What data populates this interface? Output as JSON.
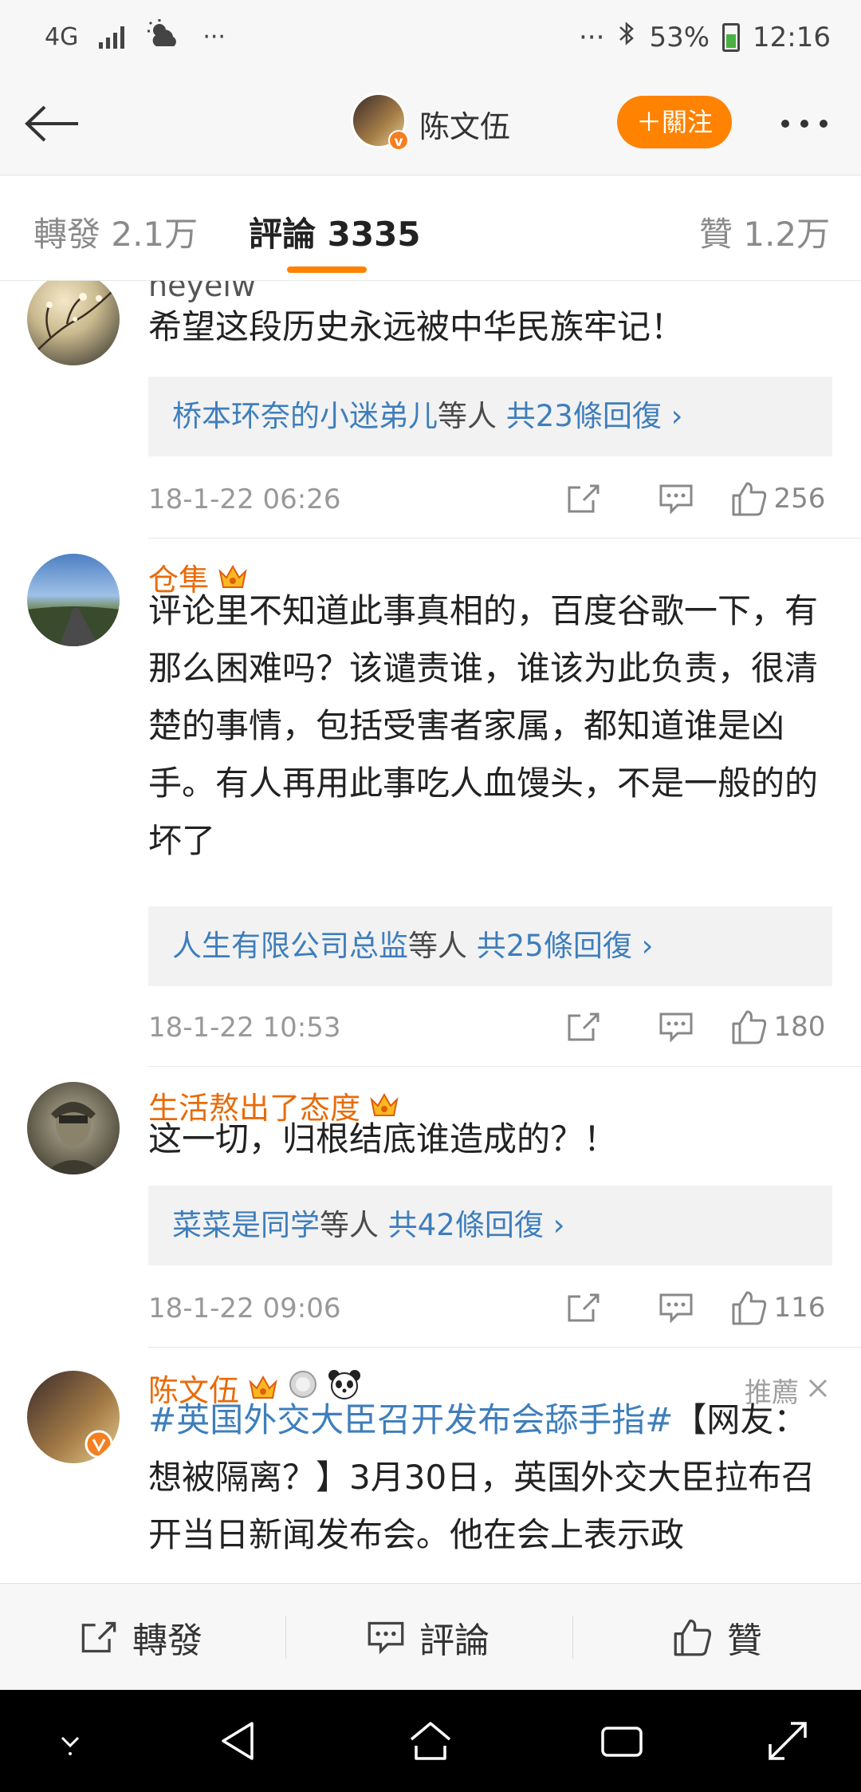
{
  "status_bar": {
    "network": "4G",
    "more": "···",
    "more_right": "···",
    "battery": "53%",
    "time": "12:16"
  },
  "header": {
    "name": "陈文伍",
    "follow_label": "＋關注"
  },
  "tabs": [
    {
      "label": "轉發 2.1万"
    },
    {
      "label": "評論 3335"
    },
    {
      "label": "贊 1.2万"
    }
  ],
  "comments": [
    {
      "user": "neyelw",
      "text": "希望这段历史永远被中华民族牢记！",
      "reply_names": "桥本环奈的小迷弟儿",
      "reply_mid": "等人",
      "reply_count": "共23條回復 ›",
      "time": "18-1-22 06:26",
      "likes": "256"
    },
    {
      "user": "仓隼",
      "text": "评论里不知道此事真相的，百度谷歌一下，有那么困难吗？该谴责谁，谁该为此负责，很清楚的事情，包括受害者家属，都知道谁是凶手。有人再用此事吃人血馒头，不是一般的的坏了",
      "reply_names": "人生有限公司总监",
      "reply_mid": "等人",
      "reply_count": "共25條回復 ›",
      "time": "18-1-22 10:53",
      "likes": "180"
    },
    {
      "user": "生活熬出了态度",
      "text": "这一切，归根结底谁造成的？！",
      "reply_names": "菜菜是同学",
      "reply_mid": "等人",
      "reply_count": "共42條回復 ›",
      "time": "18-1-22 09:06",
      "likes": "116"
    }
  ],
  "recommended": {
    "user": "陈文伍",
    "label": "推薦",
    "hashtag": "#英国外交大臣召开发布会舔手指#",
    "text": "【网友：想被隔离？】3月30日，英国外交大臣拉布召开当日新闻发布会。他在会上表示政"
  },
  "bottom_bar": {
    "repost": "轉發",
    "comment": "評論",
    "like": "贊"
  },
  "colors": {
    "accent": "#ff8200",
    "username": "#e86b0a",
    "link": "#3e7ebc"
  }
}
